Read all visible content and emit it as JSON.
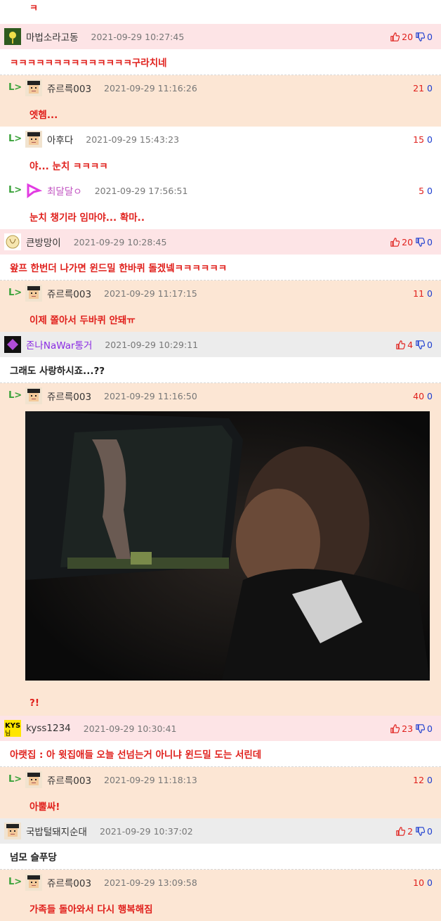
{
  "top_text": "ㅋ",
  "comments": [
    {
      "kind": "top",
      "bg": "pink",
      "nick": "마법소라고동",
      "date": "2021-09-29 10:27:45",
      "up": "20",
      "down": "0",
      "votes": "thumbs",
      "body": "ㅋㅋㅋㅋㅋㅋㅋㅋㅋㅋㅋㅋㅋㅋ구라치네",
      "body_color": "red"
    },
    {
      "kind": "reply",
      "bg": "peach",
      "nick": "쥬르륵003",
      "date": "2021-09-29 11:16:26",
      "up": "21",
      "down": "0",
      "body": "엣헴..."
    },
    {
      "kind": "reply",
      "bg": "white",
      "nick": "아후다",
      "date": "2021-09-29 15:43:23",
      "up": "15",
      "down": "0",
      "body": "야... 눈치 ㅋㅋㅋㅋ"
    },
    {
      "kind": "reply",
      "bg": "white",
      "nick": "최달달ㅇ",
      "date": "2021-09-29 17:56:51",
      "up": "5",
      "down": "0",
      "body": "눈치 챙기라 임마야... 확마..",
      "nick_color": "#c050c0"
    },
    {
      "kind": "top",
      "bg": "pink",
      "nick": "큰방망이",
      "date": "2021-09-29 10:28:45",
      "up": "20",
      "down": "0",
      "votes": "thumbs",
      "body": "왚프 한번더 나가면 윈드밀 한바퀴 돌겠넼ㅋㅋㅋㅋㅋㅋ",
      "body_color": "red"
    },
    {
      "kind": "reply",
      "bg": "peach",
      "nick": "쥬르륵003",
      "date": "2021-09-29 11:17:15",
      "up": "11",
      "down": "0",
      "body": "이제 쫄아서 두바퀴 안돼ㅠ"
    },
    {
      "kind": "top",
      "bg": "gray",
      "nick": "존나NaWar통거",
      "date": "2021-09-29 10:29:11",
      "up": "4",
      "down": "0",
      "votes": "thumbs",
      "body": "그래도 사랑하시죠...??",
      "body_color": "black",
      "nick_color": "#8a2be2"
    },
    {
      "kind": "reply",
      "bg": "peach",
      "nick": "쥬르륵003",
      "date": "2021-09-29 11:16:50",
      "up": "40",
      "down": "0",
      "body": "?!",
      "image": true
    },
    {
      "kind": "top",
      "bg": "pink",
      "nick": "kyss1234",
      "date": "2021-09-29 10:30:41",
      "up": "23",
      "down": "0",
      "votes": "thumbs",
      "body": "아랫집 : 아 윗집애들 오늘 선넘는거 아니냐 윈드밀 도는 서린데",
      "body_color": "red"
    },
    {
      "kind": "reply",
      "bg": "peach",
      "nick": "쥬르륵003",
      "date": "2021-09-29 11:18:13",
      "up": "12",
      "down": "0",
      "body": "아뿔싸!"
    },
    {
      "kind": "top",
      "bg": "gray",
      "nick": "국밥털돼지순대",
      "date": "2021-09-29 10:37:02",
      "up": "2",
      "down": "0",
      "votes": "thumbs",
      "body": "넘모 슬푸당",
      "body_color": "black"
    },
    {
      "kind": "reply",
      "bg": "peach",
      "nick": "쥬르륵003",
      "date": "2021-09-29 13:09:58",
      "up": "10",
      "down": "0",
      "body": "가족들 돌아와서 다시 행복해짐"
    }
  ],
  "reply_arrow": "L>",
  "colors": {
    "red": "#e0201c",
    "blue": "#1d3ecf",
    "pink": "#fde4e6",
    "peach": "#fce6d4",
    "gray": "#ececec"
  }
}
